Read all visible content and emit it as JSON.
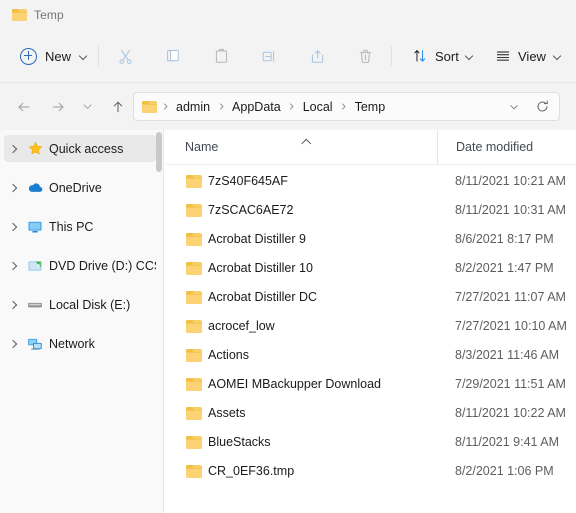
{
  "window": {
    "tab_title": "Temp",
    "tab_icon": "folder-icon"
  },
  "toolbar": {
    "new_label": "New",
    "new_icon": "plus-circle-icon",
    "new_chevron": "chevron-down-icon",
    "cut_icon": "cut-scissors-icon",
    "copy_icon": "copy-icon",
    "paste_icon": "paste-clipboard-icon",
    "rename_icon": "rename-icon",
    "share_icon": "share-icon",
    "delete_icon": "delete-trash-icon",
    "sort_label": "Sort",
    "sort_icon": "sort-arrows-icon",
    "view_label": "View",
    "view_icon": "view-lines-icon"
  },
  "navigation": {
    "back_icon": "arrow-left-icon",
    "forward_icon": "arrow-right-icon",
    "recent_icon": "chevron-down-icon",
    "up_icon": "arrow-up-icon",
    "refresh_icon": "refresh-icon",
    "address_dropdown_icon": "chevron-down-icon",
    "breadcrumb_icon": "folder-icon",
    "breadcrumbs": [
      "admin",
      "AppData",
      "Local",
      "Temp"
    ]
  },
  "sidebar": {
    "items": [
      {
        "label": "Quick access",
        "icon": "star-icon",
        "selected": true
      },
      {
        "label": "OneDrive",
        "icon": "cloud-icon",
        "selected": false
      },
      {
        "label": "This PC",
        "icon": "monitor-icon",
        "selected": false
      },
      {
        "label": "DVD Drive (D:) CCSA",
        "icon": "dvd-drive-icon",
        "selected": false
      },
      {
        "label": "Local Disk (E:)",
        "icon": "disk-icon",
        "selected": false
      },
      {
        "label": "Network",
        "icon": "network-icon",
        "selected": false
      }
    ]
  },
  "filelist": {
    "columns": {
      "name": "Name",
      "date_modified": "Date modified"
    },
    "sort_indicator": "ascending",
    "rows": [
      {
        "name": "7zS40F645AF",
        "date": "8/11/2021 10:21 AM",
        "icon": "folder-icon"
      },
      {
        "name": "7zSCAC6AE72",
        "date": "8/11/2021 10:31 AM",
        "icon": "folder-icon"
      },
      {
        "name": "Acrobat Distiller 9",
        "date": "8/6/2021 8:17 PM",
        "icon": "folder-icon"
      },
      {
        "name": "Acrobat Distiller 10",
        "date": "8/2/2021 1:47 PM",
        "icon": "folder-icon"
      },
      {
        "name": "Acrobat Distiller DC",
        "date": "7/27/2021 11:07 AM",
        "icon": "folder-icon"
      },
      {
        "name": "acrocef_low",
        "date": "7/27/2021 10:10 AM",
        "icon": "folder-icon"
      },
      {
        "name": "Actions",
        "date": "8/3/2021 11:46 AM",
        "icon": "folder-icon"
      },
      {
        "name": "AOMEI MBackupper Download",
        "date": "7/29/2021 11:51 AM",
        "icon": "folder-icon"
      },
      {
        "name": "Assets",
        "date": "8/11/2021 10:22 AM",
        "icon": "folder-icon"
      },
      {
        "name": "BlueStacks",
        "date": "8/11/2021 9:41 AM",
        "icon": "folder-icon"
      },
      {
        "name": "CR_0EF36.tmp",
        "date": "8/2/2021 1:06 PM",
        "icon": "folder-icon"
      }
    ]
  },
  "colors": {
    "folder": "#fbd274",
    "accent": "#2b6bbd",
    "star": "#ffb900",
    "onedrive": "#0f78d4",
    "window_bg": "#f3f3f3",
    "pane_bg": "#ffffff",
    "sidebar_bg": "#f9f9f9",
    "selection": "#e9e9e9"
  }
}
